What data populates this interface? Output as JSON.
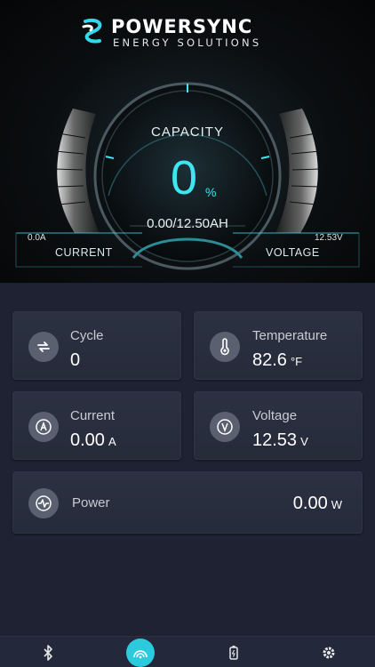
{
  "brand": {
    "name": "POWERSYNC",
    "subtitle": "ENERGY SOLUTIONS"
  },
  "gauge": {
    "capacity_label": "CAPACITY",
    "capacity_value": "0",
    "capacity_unit": "%",
    "amp_hours": "0.00/12.50AH",
    "current_label": "CURRENT",
    "current_value": "0.0A",
    "voltage_label": "VOLTAGE",
    "voltage_value": "12.53V",
    "capacity_fraction": 0
  },
  "cards": {
    "cycle": {
      "title": "Cycle",
      "value": "0",
      "icon": "cycle-arrows-icon"
    },
    "temperature": {
      "title": "Temperature",
      "value": "82.6",
      "unit": "°F",
      "icon": "thermometer-icon"
    },
    "current": {
      "title": "Current",
      "value": "0.00",
      "unit": "A",
      "icon": "ammeter-icon"
    },
    "voltage": {
      "title": "Voltage",
      "value": "12.53",
      "unit": "V",
      "icon": "voltmeter-icon"
    },
    "power": {
      "title": "Power",
      "value": "0.00",
      "unit": "W",
      "icon": "pulse-icon"
    }
  },
  "tabs": [
    {
      "name": "bluetooth",
      "icon": "bluetooth-icon",
      "active": false
    },
    {
      "name": "dashboard",
      "icon": "gauge-icon",
      "active": true
    },
    {
      "name": "battery",
      "icon": "battery-icon",
      "active": false
    },
    {
      "name": "settings",
      "icon": "gear-icon",
      "active": false
    }
  ],
  "colors": {
    "accent": "#3ee6f2",
    "card": "#2a2f3f",
    "background": "#1e2233",
    "active_tab": "#2dc9dd"
  }
}
